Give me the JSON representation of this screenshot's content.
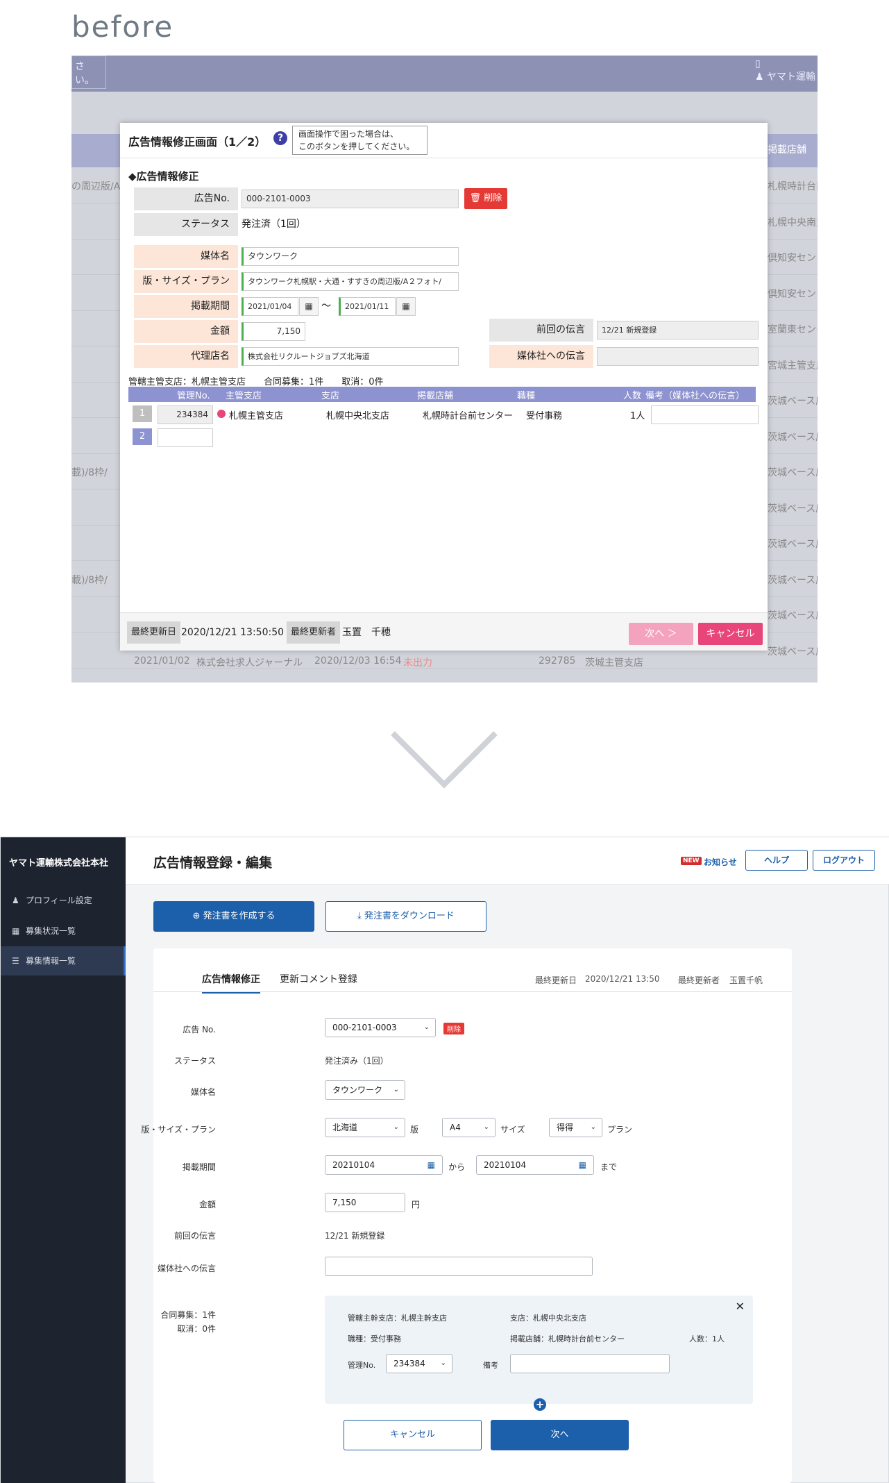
{
  "before_label": "before",
  "before": {
    "bg_fragments": {
      "topbar_left": "さい。",
      "topbar_right": "ヤマト運輸",
      "header_right": "掲載店舗",
      "left_rows": [
        "の周辺版/A…",
        "",
        "",
        "",
        "",
        "",
        "",
        "",
        "載)/8枠/",
        "",
        "",
        "載)/8枠/"
      ],
      "right_rows": [
        "札幌時計台前",
        "札幌中央南支",
        "倶知安センタ",
        "倶知安センタ",
        "室蘭東センタ",
        "宮城主管支店",
        "茨城ベース店",
        "茨城ベース店",
        "茨城ベース店",
        "茨城ベース店",
        "茨城ベース店",
        "茨城ベース店",
        "茨城ベース店",
        "茨城ベース店"
      ],
      "behind_row": [
        "2021/01/02",
        "株式会社求人ジャーナル",
        "2020/12/03 16:54",
        "未出力",
        "292785",
        "茨城主管支店"
      ]
    },
    "modal": {
      "title": "広告情報修正画面（1／2）",
      "help_icon": "?",
      "help_tip_line1": "画面操作で困った場合は、",
      "help_tip_line2": "このボタンを押してください。",
      "section_title": "◆広告情報修正",
      "ad_no_label": "広告No.",
      "ad_no_value": "000-2101-0003",
      "delete_label": "🗑 削除",
      "status_label": "ステータス",
      "status_value": "発注済（1回）",
      "media_label": "媒体名",
      "media_value": "タウンワーク",
      "plan_label": "版・サイズ・プラン",
      "plan_value": "タウンワーク札幌駅・大通・すすきの周辺版/A２フォト/",
      "period_label": "掲載期間",
      "period_from": "2021/01/04",
      "period_sep": "～",
      "period_to": "2021/01/11",
      "amount_label": "金額",
      "amount_value": "7,150",
      "agency_label": "代理店名",
      "agency_value": "株式会社リクルートジョブズ北海道",
      "prev_msg_label": "前回の伝言",
      "prev_msg_value": "12/21 新規登録",
      "media_msg_label": "媒体社への伝言",
      "media_msg_value": "",
      "summary": "管轄主管支店：札幌主管支店　　合同募集：1件　　取消：0件",
      "table_headers": [
        "管理No.",
        "主管支店",
        "支店",
        "掲載店舗",
        "職種",
        "人数",
        "備考（媒体社への伝言）"
      ],
      "row1": {
        "num": "1",
        "mgmt_no": "234384",
        "main_branch": "札幌主管支店",
        "branch": "札幌中央北支店",
        "store": "札幌時計台前センター",
        "job": "受付事務",
        "count": "1人"
      },
      "row2": {
        "num": "2"
      },
      "footer_updated_label": "最終更新日",
      "footer_updated_value": "2020/12/21 13:50:50",
      "footer_updater_label": "最終更新者",
      "footer_updater_value": "玉置　千穂",
      "next_btn": "次へ ＞",
      "cancel_btn": "キャンセル"
    }
  },
  "after": {
    "sidebar": {
      "title": "ヤマト運輸株式会社本社",
      "items": [
        {
          "label": "プロフィール設定",
          "icon": "person-icon"
        },
        {
          "label": "募集状況一覧",
          "icon": "calendar-icon"
        },
        {
          "label": "募集情報一覧",
          "icon": "list-icon"
        }
      ]
    },
    "topbar": {
      "title": "広告情報登録・編集",
      "new_badge": "NEW",
      "news": "お知らせ",
      "help": "ヘルプ",
      "logout": "ログアウト"
    },
    "actions": {
      "create": "⊕ 発注書を作成する",
      "download": "⤓ 発注書をダウンロード"
    },
    "tabs": [
      "広告情報修正",
      "更新コメント登録"
    ],
    "meta": {
      "updated_label": "最終更新日",
      "updated_value": "2020/12/21 13:50",
      "updater_label": "最終更新者",
      "updater_value": "玉置千帆"
    },
    "form": {
      "ad_no_label": "広告 No.",
      "ad_no_value": "000-2101-0003",
      "delete": "削除",
      "status_label": "ステータス",
      "status_value": "発注済み（1回）",
      "media_label": "媒体名",
      "media_value": "タウンワーク",
      "plan_label": "版・サイズ・プラン",
      "edition_value": "北海道",
      "edition_unit": "版",
      "size_value": "A4",
      "size_unit": "サイズ",
      "plan_value": "得得",
      "plan_unit": "プラン",
      "period_label": "掲載期間",
      "period_from": "20210104",
      "period_from_unit": "から",
      "period_to": "20210104",
      "period_to_unit": "まで",
      "amount_label": "金額",
      "amount_value": "7,150",
      "amount_unit": "円",
      "prev_msg_label": "前回の伝言",
      "prev_msg_value": "12/21 新規登録",
      "media_msg_label": "媒体社への伝言",
      "media_msg_value": "",
      "joint_label_1": "合同募集：1件",
      "joint_label_2": "取消：0件"
    },
    "joint": {
      "main_branch": "管轄主幹支店：札幌主幹支店",
      "branch": "支店：札幌中央北支店",
      "job": "職種：受付事務",
      "store": "掲載店舗：札幌時計台前センター",
      "count": "人数：1人",
      "mgmt_label": "管理No.",
      "mgmt_value": "234384",
      "note_label": "備考",
      "note_value": ""
    },
    "buttons": {
      "cancel": "キャンセル",
      "next": "次へ"
    }
  }
}
